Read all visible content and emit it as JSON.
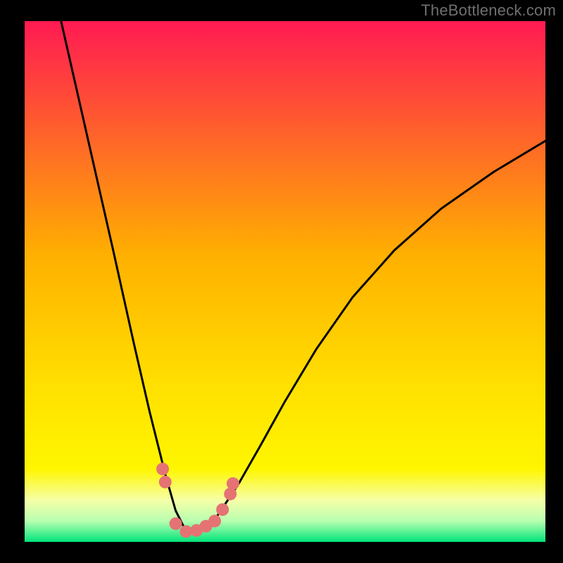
{
  "watermark": "TheBottleneck.com",
  "colors": {
    "bg": "#000000",
    "grad_top": "#ff1a52",
    "grad_mid": "#ffd200",
    "grad_yellow": "#fff200",
    "grad_pale": "#f8ffb0",
    "grad_green": "#00e47a",
    "curve": "#000000",
    "dots": "#e57373"
  },
  "plot": {
    "inner_x": 35,
    "inner_y": 30,
    "inner_w": 740,
    "inner_h": 740
  },
  "chart_data": {
    "type": "line",
    "title": "",
    "xlabel": "",
    "ylabel": "",
    "xlim": [
      0,
      1
    ],
    "ylim": [
      0,
      1
    ],
    "series": [
      {
        "name": "bottleneck-curve",
        "x": [
          0.07,
          0.12,
          0.17,
          0.21,
          0.24,
          0.27,
          0.29,
          0.31,
          0.33,
          0.37,
          0.41,
          0.45,
          0.5,
          0.56,
          0.63,
          0.71,
          0.8,
          0.9,
          1.0
        ],
        "y": [
          1.0,
          0.78,
          0.56,
          0.38,
          0.25,
          0.13,
          0.06,
          0.02,
          0.02,
          0.05,
          0.11,
          0.18,
          0.27,
          0.37,
          0.47,
          0.56,
          0.64,
          0.71,
          0.77
        ]
      }
    ],
    "marker_points": {
      "name": "highlight-dots",
      "x": [
        0.265,
        0.27,
        0.29,
        0.31,
        0.33,
        0.348,
        0.365,
        0.38,
        0.395,
        0.4
      ],
      "y": [
        0.14,
        0.115,
        0.035,
        0.02,
        0.022,
        0.03,
        0.04,
        0.062,
        0.092,
        0.112
      ]
    }
  }
}
